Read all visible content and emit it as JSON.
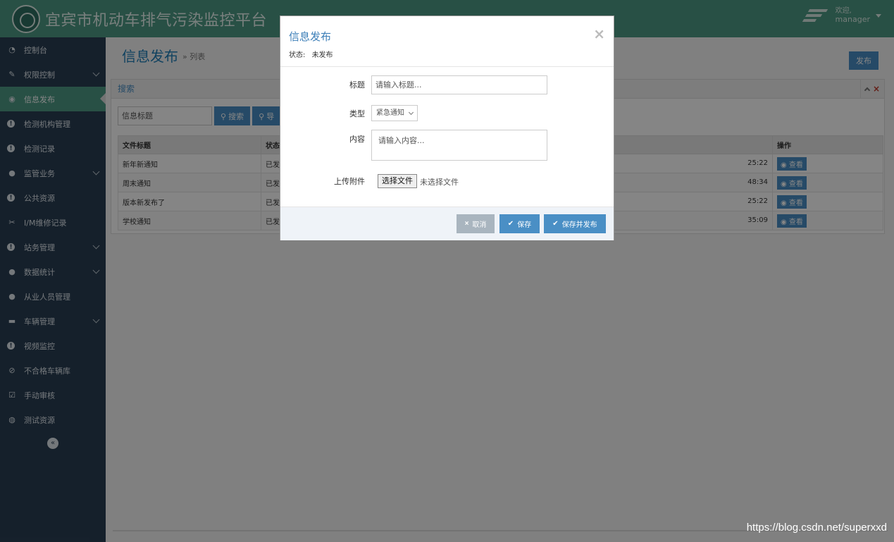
{
  "header": {
    "title": "宜宾市机动车排气污染监控平台",
    "welcome": "欢迎,",
    "username": "manager"
  },
  "sidebar": {
    "items": [
      {
        "label": "控制台",
        "icon": "dashboard-icon"
      },
      {
        "label": "权限控制",
        "icon": "pen-icon",
        "expandable": true
      },
      {
        "label": "信息发布",
        "icon": "eye-icon",
        "active": true
      },
      {
        "label": "检测机构管理",
        "icon": "info-circle-icon"
      },
      {
        "label": "检测记录",
        "icon": "info-circle-icon"
      },
      {
        "label": "监管业务",
        "icon": "user-icon",
        "expandable": true
      },
      {
        "label": "公共资源",
        "icon": "info-circle-icon"
      },
      {
        "label": "I/M维修记录",
        "icon": "wrench-icon"
      },
      {
        "label": "站务管理",
        "icon": "info-circle-icon",
        "expandable": true
      },
      {
        "label": "数据统计",
        "icon": "user-icon",
        "expandable": true
      },
      {
        "label": "从业人员管理",
        "icon": "user-icon"
      },
      {
        "label": "车辆管理",
        "icon": "car-icon",
        "expandable": true
      },
      {
        "label": "视频监控",
        "icon": "info-circle-icon"
      },
      {
        "label": "不合格车辆库",
        "icon": "ban-icon"
      },
      {
        "label": "手动审核",
        "icon": "check-square-icon"
      },
      {
        "label": "测试资源",
        "icon": "globe-icon"
      }
    ],
    "collapse_symbol": "«"
  },
  "page": {
    "title": "信息发布",
    "crumb": "» 列表",
    "publish_label": "发布"
  },
  "search": {
    "panel_title": "搜索",
    "placeholder": "信息标题",
    "search_label": "搜索",
    "second_label": "导"
  },
  "table": {
    "headers": [
      "文件标题",
      "状态",
      "操作"
    ],
    "rows": [
      {
        "title": "新年新通知",
        "status": "已发",
        "time": "25:22",
        "action": "查看"
      },
      {
        "title": "周末通知",
        "status": "已发",
        "time": "48:34",
        "action": "查看"
      },
      {
        "title": "版本新发布了",
        "status": "已发",
        "time": "25:22",
        "action": "查看"
      },
      {
        "title": "学校通知",
        "status": "已发",
        "time": "35:09",
        "action": "查看"
      }
    ]
  },
  "modal": {
    "title": "信息发布",
    "status_label": "状态:",
    "status_value": "未发布",
    "close_symbol": "×",
    "fields": {
      "title_label": "标题",
      "title_placeholder": "请输入标题...",
      "type_label": "类型",
      "type_value": "紧急通知",
      "content_label": "内容",
      "content_placeholder": "请输入内容...",
      "attachment_label": "上传附件",
      "file_button": "选择文件",
      "file_none": "未选择文件"
    },
    "buttons": {
      "cancel": "取消",
      "save": "保存",
      "save_publish": "保存并发布"
    }
  },
  "colors": {
    "header": "#4e9a85",
    "sidebar": "#2a3f54",
    "primary": "#4a8fc5",
    "cancel": "#a9b5bf"
  },
  "watermark": "https://blog.csdn.net/superxxd"
}
